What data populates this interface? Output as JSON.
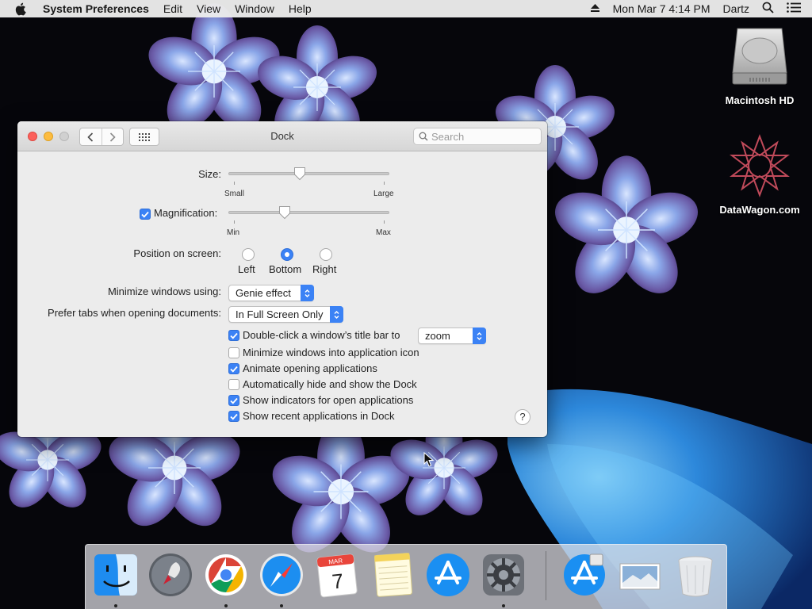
{
  "menubar": {
    "app_name": "System Preferences",
    "menus": [
      "Edit",
      "View",
      "Window",
      "Help"
    ],
    "datetime": "Mon Mar 7  4:14 PM",
    "user": "Dartz"
  },
  "desktop": {
    "icons": [
      {
        "label": "Macintosh HD",
        "icon": "hard-drive-icon"
      },
      {
        "label": "DataWagon.com",
        "icon": "datawagon-icon"
      }
    ]
  },
  "window": {
    "title": "Dock",
    "search_placeholder": "Search",
    "size": {
      "label": "Size:",
      "min_label": "Small",
      "max_label": "Large",
      "value": 0.44
    },
    "magnification": {
      "label": "Magnification:",
      "checked": true,
      "min_label": "Min",
      "max_label": "Max",
      "value": 0.34
    },
    "position": {
      "label": "Position on screen:",
      "options": [
        "Left",
        "Bottom",
        "Right"
      ],
      "selected": "Bottom"
    },
    "minimize_using": {
      "label": "Minimize windows using:",
      "value": "Genie effect"
    },
    "prefer_tabs": {
      "label": "Prefer tabs when opening documents:",
      "value": "In Full Screen Only"
    },
    "double_click": {
      "label": "Double-click a window’s title bar to",
      "checked": true,
      "value": "zoom"
    },
    "options": [
      {
        "label": "Minimize windows into application icon",
        "checked": false
      },
      {
        "label": "Animate opening applications",
        "checked": true
      },
      {
        "label": "Automatically hide and show the Dock",
        "checked": false
      },
      {
        "label": "Show indicators for open applications",
        "checked": true
      },
      {
        "label": "Show recent applications in Dock",
        "checked": true
      }
    ],
    "help_label": "?"
  },
  "calendar": {
    "month": "MAR",
    "day": "7"
  },
  "dock": {
    "apps": [
      "Finder",
      "Launchpad",
      "Google Chrome",
      "Safari",
      "Calendar",
      "Notes",
      "App Store",
      "System Preferences",
      "App Store Installer",
      "Preview",
      "Trash"
    ]
  },
  "colors": {
    "accent": "#3b82f5",
    "window_bg": "#ececec"
  }
}
